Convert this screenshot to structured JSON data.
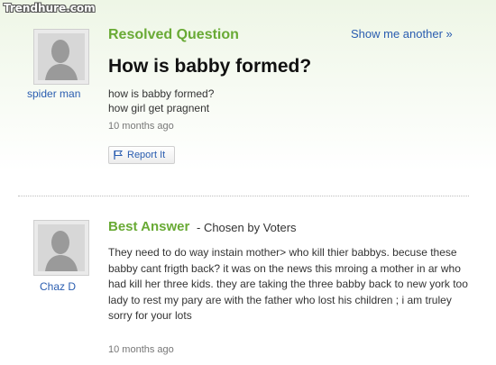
{
  "watermark": "Trendhure.com",
  "question": {
    "status_heading": "Resolved Question",
    "show_another": "Show me another »",
    "title": "How is babby formed?",
    "asker": "spider man",
    "body_lines": [
      "how is babby formed?",
      "how girl get pragnent"
    ],
    "time_ago": "10 months ago",
    "report_label": "Report It"
  },
  "answer": {
    "heading": "Best Answer",
    "chosen_by": "- Chosen by Voters",
    "answerer": "Chaz D",
    "body": "They need to do way instain mother> who kill thier babbys. becuse these babby cant frigth back? it was on the news this mroing a mother in ar who had kill her three kids. they are taking the three babby back to new york too lady to rest my pary are with the father who lost his children ; i am truley sorry for your lots",
    "time_ago": "10 months ago"
  },
  "icons": [
    "user-silhouette-icon",
    "flag-icon"
  ],
  "colors": {
    "heading_green": "#69aa35",
    "link_blue": "#2a5db0"
  }
}
